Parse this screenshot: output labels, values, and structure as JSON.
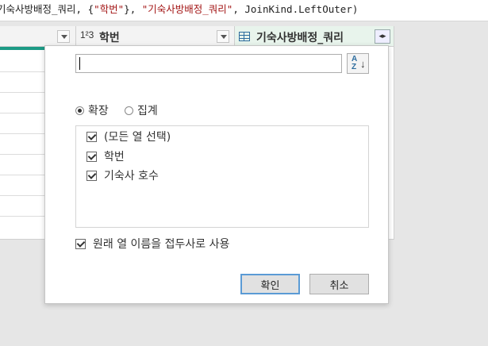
{
  "formula_bar": {
    "prefix": "기숙사방배정_쿼리, {",
    "str1": "\"학번\"",
    "mid": "}, ",
    "str2": "\"기숙사방배정_쿼리\"",
    "suffix": ", JoinKind.LeftOuter)"
  },
  "grid": {
    "type_icon": "1²3",
    "column_b_label": "학번",
    "column_c_label": "기숙사방배정_쿼리",
    "expand_icon": "◂▸"
  },
  "dialog": {
    "search": {
      "value": "",
      "placeholder": ""
    },
    "sort_icon_label": "A↓Z",
    "mode_options": [
      {
        "label": "확장",
        "selected": true
      },
      {
        "label": "집계",
        "selected": false
      }
    ],
    "columns": [
      {
        "label": "(모든 열 선택)",
        "checked": true
      },
      {
        "label": "학번",
        "checked": true
      },
      {
        "label": "기숙사 호수",
        "checked": true
      }
    ],
    "use_prefix": {
      "label": "원래 열 이름을 접두사로 사용",
      "checked": true
    },
    "ok_label": "확인",
    "cancel_label": "취소"
  },
  "colors": {
    "accent_teal": "#1c9a85",
    "string_literal": "#a31515",
    "primary_border": "#5b9bd5"
  }
}
